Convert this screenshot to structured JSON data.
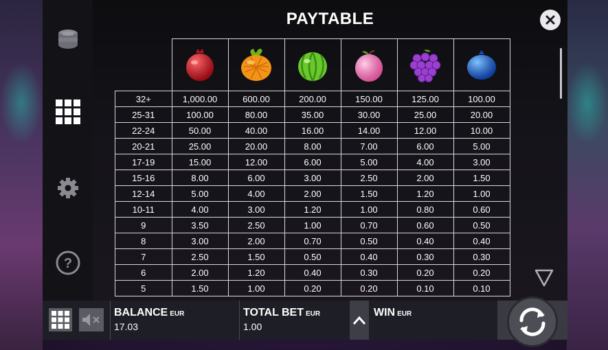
{
  "header": {
    "title": "PAYTABLE"
  },
  "sidebar": {
    "items": [
      {
        "icon": "coins-icon",
        "label": ""
      },
      {
        "icon": "grid-icon",
        "label": ""
      },
      {
        "icon": "gear-icon",
        "label": ""
      },
      {
        "icon": "help-icon",
        "label": ""
      }
    ]
  },
  "paytable": {
    "symbols": [
      "pomegranate",
      "orange-pineapple",
      "watermelon",
      "peach",
      "grapes",
      "blueberry"
    ],
    "rows": [
      {
        "count": "32+",
        "pays": [
          "1,000.00",
          "600.00",
          "200.00",
          "150.00",
          "125.00",
          "100.00"
        ]
      },
      {
        "count": "25-31",
        "pays": [
          "100.00",
          "80.00",
          "35.00",
          "30.00",
          "25.00",
          "20.00"
        ]
      },
      {
        "count": "22-24",
        "pays": [
          "50.00",
          "40.00",
          "16.00",
          "14.00",
          "12.00",
          "10.00"
        ]
      },
      {
        "count": "20-21",
        "pays": [
          "25.00",
          "20.00",
          "8.00",
          "7.00",
          "6.00",
          "5.00"
        ]
      },
      {
        "count": "17-19",
        "pays": [
          "15.00",
          "12.00",
          "6.00",
          "5.00",
          "4.00",
          "3.00"
        ]
      },
      {
        "count": "15-16",
        "pays": [
          "8.00",
          "6.00",
          "3.00",
          "2.50",
          "2.00",
          "1.50"
        ]
      },
      {
        "count": "12-14",
        "pays": [
          "5.00",
          "4.00",
          "2.00",
          "1.50",
          "1.20",
          "1.00"
        ]
      },
      {
        "count": "10-11",
        "pays": [
          "4.00",
          "3.00",
          "1.20",
          "1.00",
          "0.80",
          "0.60"
        ]
      },
      {
        "count": "9",
        "pays": [
          "3.50",
          "2.50",
          "1.00",
          "0.70",
          "0.60",
          "0.50"
        ]
      },
      {
        "count": "8",
        "pays": [
          "3.00",
          "2.00",
          "0.70",
          "0.50",
          "0.40",
          "0.40"
        ]
      },
      {
        "count": "7",
        "pays": [
          "2.50",
          "1.50",
          "0.50",
          "0.40",
          "0.30",
          "0.30"
        ]
      },
      {
        "count": "6",
        "pays": [
          "2.00",
          "1.20",
          "0.40",
          "0.30",
          "0.20",
          "0.20"
        ]
      },
      {
        "count": "5",
        "pays": [
          "1.50",
          "1.00",
          "0.20",
          "0.20",
          "0.10",
          "0.10"
        ]
      }
    ]
  },
  "bottom_bar": {
    "balance": {
      "label": "BALANCE",
      "currency": "EUR",
      "value": "17.03"
    },
    "total_bet": {
      "label": "TOTAL BET",
      "currency": "EUR",
      "value": "1.00"
    },
    "win": {
      "label": "WIN",
      "currency": "EUR",
      "value": ""
    }
  },
  "colors": {
    "panel_bg": "#0d0d10",
    "sidebar_bg": "#131217",
    "bottom_bar_bg": "#1e1e26",
    "grid_line": "#d8d8dc"
  }
}
